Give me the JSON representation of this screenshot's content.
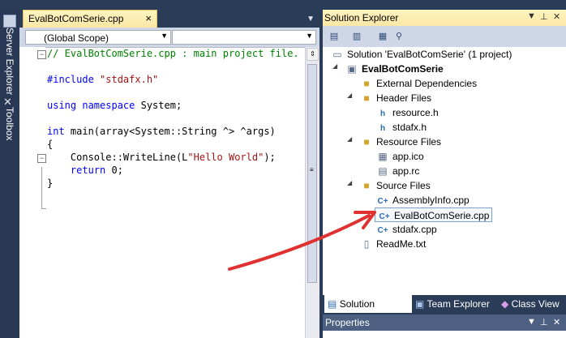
{
  "left_strip": {
    "server_explorer_label": "Server Explorer",
    "toolbox_label": "Toolbox"
  },
  "editor": {
    "tab_title": "EvalBotComSerie.cpp",
    "tab_close": "×",
    "scope_combo": "(Global Scope)",
    "member_combo": "",
    "code": {
      "comment": "// EvalBotComSerie.cpp : main project file.",
      "include_kw": "#include",
      "include_str": "\"stdafx.h\"",
      "using_kw": "using namespace",
      "using_rest": " System;",
      "int_kw": "int",
      "main_sig": " main(array<System::String ^> ^args)",
      "open_brace": "{",
      "writeline_pre": "    Console::WriteLine(L",
      "writeline_str": "\"Hello World\"",
      "writeline_post": ");",
      "return_kw": "    return",
      "return_rest": " 0;",
      "close_brace": "}"
    }
  },
  "solution_explorer": {
    "title": "Solution Explorer",
    "solution": "Solution 'EvalBotComSerie' (1 project)",
    "project": "EvalBotComSerie",
    "items": {
      "external_deps": "External Dependencies",
      "header_files": "Header Files",
      "resource_h": "resource.h",
      "stdafx_h": "stdafx.h",
      "resource_files": "Resource Files",
      "app_ico": "app.ico",
      "app_rc": "app.rc",
      "source_files": "Source Files",
      "assemblyinfo": "AssemblyInfo.cpp",
      "evalbot_cpp": "EvalBotComSerie.cpp",
      "stdafx_cpp": "stdafx.cpp",
      "readme": "ReadMe.txt"
    },
    "tabs": {
      "solution": "Solution Explor...",
      "team": "Team Explorer",
      "class": "Class View"
    }
  },
  "properties": {
    "title": "Properties"
  },
  "colors": {
    "arrow": "#e03030",
    "selected_border": "#7da2ce"
  }
}
